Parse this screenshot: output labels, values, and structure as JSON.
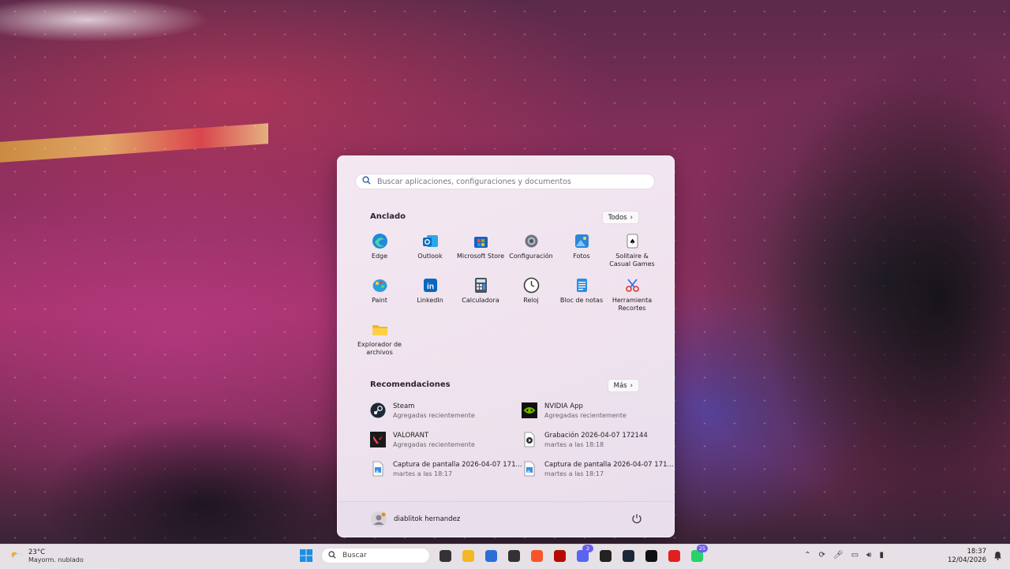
{
  "start_menu": {
    "search_placeholder": "Buscar aplicaciones, configuraciones y documentos",
    "pinned_title": "Anclado",
    "all_button": "Todos",
    "pinned": [
      {
        "label": "Edge",
        "icon": "edge-icon",
        "color": "#1f8ad8"
      },
      {
        "label": "Outlook",
        "icon": "outlook-icon",
        "color": "#0f6cbd"
      },
      {
        "label": "Microsoft Store",
        "icon": "store-icon",
        "color": "#2b6fd6"
      },
      {
        "label": "Configuración",
        "icon": "gear-icon",
        "color": "#6b7380"
      },
      {
        "label": "Fotos",
        "icon": "photos-icon",
        "color": "#2f86d6"
      },
      {
        "label": "Solitaire & Casual Games",
        "icon": "solitaire-icon",
        "color": "#ffffff"
      },
      {
        "label": "Paint",
        "icon": "paint-icon",
        "color": "#2aa0d8"
      },
      {
        "label": "LinkedIn",
        "icon": "linkedin-icon",
        "color": "#0a66c2"
      },
      {
        "label": "Calculadora",
        "icon": "calculator-icon",
        "color": "#4a5560"
      },
      {
        "label": "Reloj",
        "icon": "clock-icon",
        "color": "#3a3a3a"
      },
      {
        "label": "Bloc de notas",
        "icon": "notepad-icon",
        "color": "#2b8fe0"
      },
      {
        "label": "Herramienta Recortes",
        "icon": "snipping-icon",
        "color": "#e0473f"
      },
      {
        "label": "Explorador de archivos",
        "icon": "folder-icon",
        "color": "#f2b825"
      }
    ],
    "recs_title": "Recomendaciones",
    "more_button": "Más",
    "recommendations": [
      {
        "name": "Steam",
        "sub": "Agregadas recientemente",
        "icon": "steam-icon",
        "color": "#1b2838"
      },
      {
        "name": "NVIDIA App",
        "sub": "Agregadas recientemente",
        "icon": "nvidia-icon",
        "color": "#111111"
      },
      {
        "name": "VALORANT",
        "sub": "Agregadas recientemente",
        "icon": "valorant-icon",
        "color": "#1a1a1a"
      },
      {
        "name": "Grabación 2026-04-07 172144",
        "sub": "martes a las 18:18",
        "icon": "video-file-icon",
        "color": "#ffffff"
      },
      {
        "name": "Captura de pantalla 2026-04-07 171...",
        "sub": "martes a las 18:17",
        "icon": "image-file-icon",
        "color": "#ffffff"
      },
      {
        "name": "Captura de pantalla 2026-04-07 171...",
        "sub": "martes a las 18:17",
        "icon": "image-file-icon",
        "color": "#ffffff"
      }
    ],
    "user_name": "diablitok hernandez"
  },
  "taskbar": {
    "weather_temp": "23°C",
    "weather_desc": "Mayorm. nublado",
    "search_label": "Buscar",
    "apps": [
      {
        "icon": "task-view-icon",
        "color": "#333333"
      },
      {
        "icon": "file-explorer-icon",
        "color": "#f2b825"
      },
      {
        "icon": "store-icon",
        "color": "#2b6fd6"
      },
      {
        "icon": "app-cube-icon",
        "color": "#333333"
      },
      {
        "icon": "brave-icon",
        "color": "#fb542b"
      },
      {
        "icon": "acrobat-icon",
        "color": "#b30b00"
      },
      {
        "icon": "discord-icon",
        "color": "#5865f2",
        "badge": "2"
      },
      {
        "icon": "riot-icon",
        "color": "#222222"
      },
      {
        "icon": "steam-icon",
        "color": "#1b2838"
      },
      {
        "icon": "capcut-icon",
        "color": "#111111"
      },
      {
        "icon": "record-icon",
        "color": "#e02020"
      },
      {
        "icon": "whatsapp-icon",
        "color": "#25d366",
        "badge": "25"
      }
    ],
    "time": "18:37",
    "date": "12/04/2026"
  }
}
